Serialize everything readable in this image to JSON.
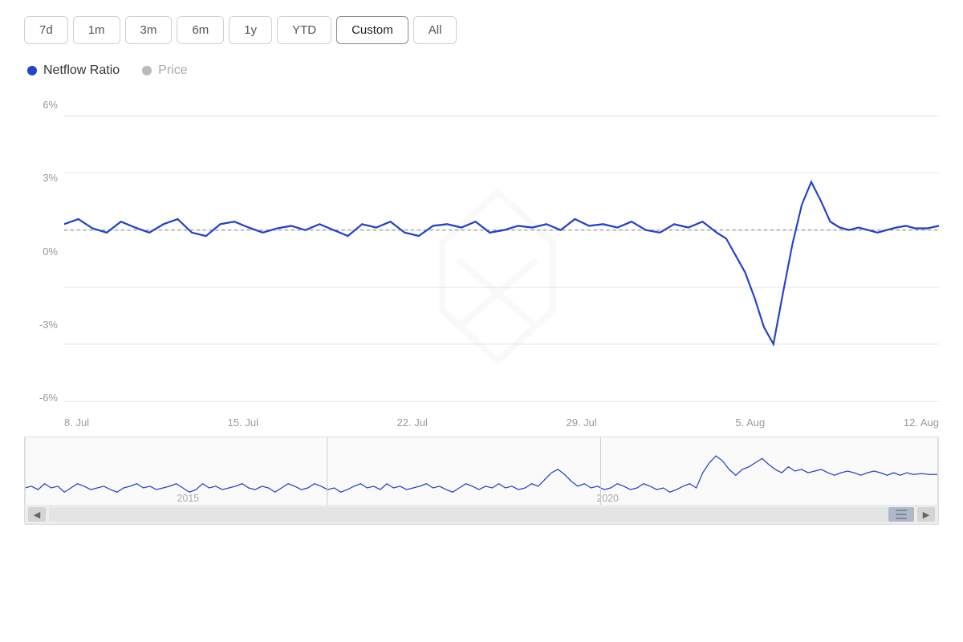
{
  "timeRange": {
    "buttons": [
      "7d",
      "1m",
      "3m",
      "6m",
      "1y",
      "YTD",
      "Custom",
      "All"
    ],
    "active": "Custom"
  },
  "legend": {
    "items": [
      {
        "key": "netflow",
        "label": "Netflow Ratio",
        "color": "#2244cc",
        "active": true
      },
      {
        "key": "price",
        "label": "Price",
        "color": "#bbbbbb",
        "active": false
      }
    ]
  },
  "yAxis": {
    "labels": [
      "6%",
      "3%",
      "0%",
      "-3%",
      "-6%"
    ]
  },
  "xAxis": {
    "labels": [
      "8. Jul",
      "15. Jul",
      "22. Jul",
      "29. Jul",
      "5. Aug",
      "12. Aug"
    ]
  },
  "watermark": "IntoTheBlock",
  "chart": {
    "zeroLineY": 62,
    "mainLineColor": "#2244cc",
    "gridLineColor": "#e8e8e8",
    "dotLineColor": "#999"
  },
  "navigator": {
    "yearLabels": [
      "2015",
      "2020"
    ],
    "lineColor": "#2244cc"
  }
}
